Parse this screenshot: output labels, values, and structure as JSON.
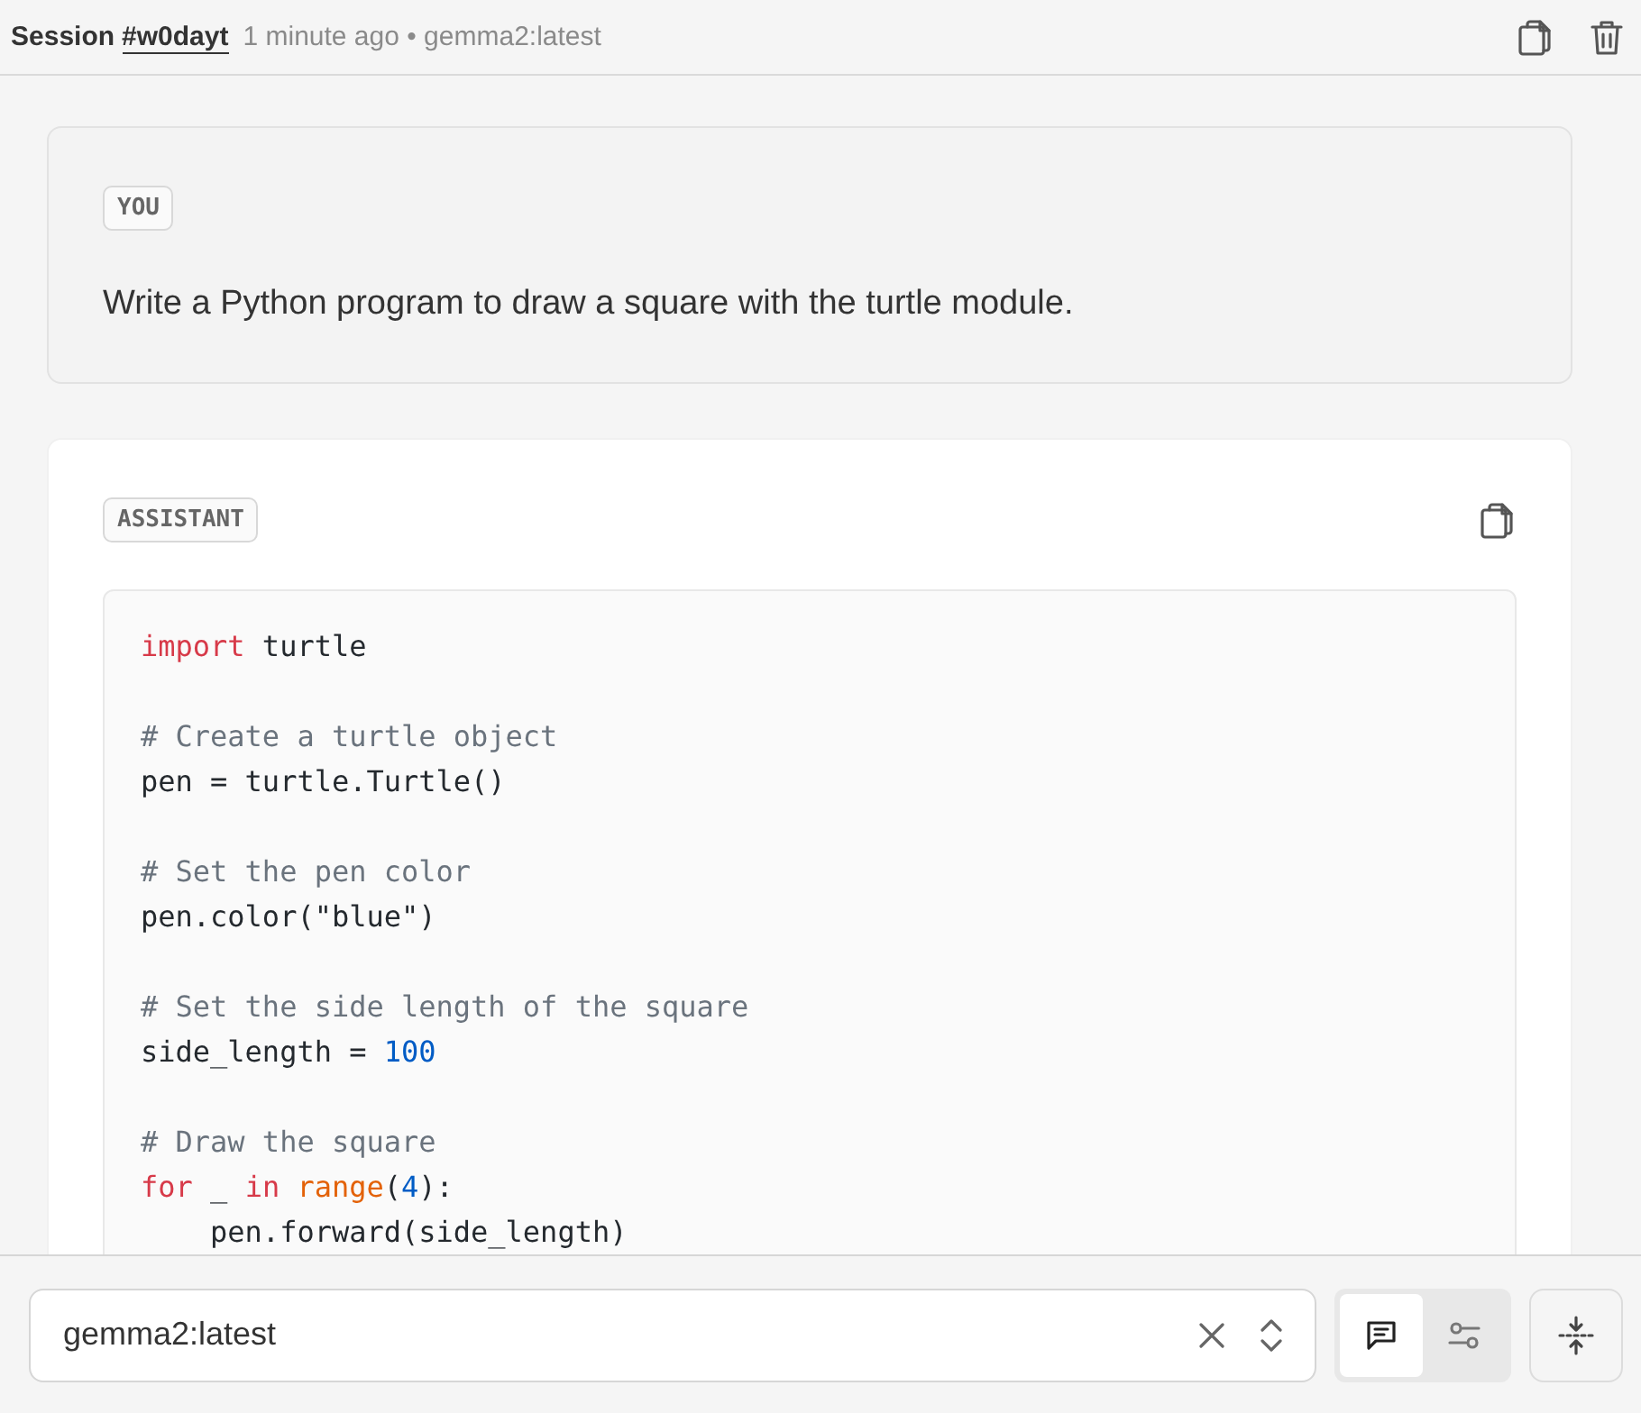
{
  "header": {
    "label": "Session",
    "session_id": "#w0dayt",
    "meta": "1 minute ago • gemma2:latest"
  },
  "messages": [
    {
      "kind": "user",
      "role_label": "YOU",
      "text": "Write a Python program to draw a square with the turtle module."
    },
    {
      "kind": "assistant",
      "role_label": "ASSISTANT",
      "code_blocks": [
        [
          [
            {
              "t": "import",
              "kind": "keyword"
            },
            {
              "t": " turtle",
              "kind": "plain"
            }
          ]
        ],
        [
          [
            {
              "t": "# Create a turtle object",
              "kind": "comment"
            }
          ],
          [
            {
              "t": "pen = turtle.Turtle()",
              "kind": "plain"
            }
          ]
        ],
        [
          [
            {
              "t": "# Set the pen color",
              "kind": "comment"
            }
          ],
          [
            {
              "t": "pen.color(\"blue\")",
              "kind": "plain"
            }
          ]
        ],
        [
          [
            {
              "t": "# Set the side length of the square",
              "kind": "comment"
            }
          ],
          [
            {
              "t": "side_length = ",
              "kind": "plain"
            },
            {
              "t": "100",
              "kind": "number"
            }
          ]
        ],
        [
          [
            {
              "t": "# Draw the square",
              "kind": "comment"
            }
          ],
          [
            {
              "t": "for",
              "kind": "keyword"
            },
            {
              "t": " _ ",
              "kind": "plain"
            },
            {
              "t": "in",
              "kind": "keyword"
            },
            {
              "t": " range",
              "kind": "builtin"
            },
            {
              "t": "(",
              "kind": "plain"
            },
            {
              "t": "4",
              "kind": "number"
            },
            {
              "t": "):",
              "kind": "plain"
            }
          ],
          [
            {
              "t": "    pen.forward(side_length)",
              "kind": "plain"
            }
          ]
        ]
      ]
    }
  ],
  "footer": {
    "model_field": {
      "value": "gemma2:latest"
    },
    "mode_buttons": [
      {
        "kind": "chat",
        "selected": true
      },
      {
        "kind": "settings",
        "selected": false
      }
    ]
  }
}
